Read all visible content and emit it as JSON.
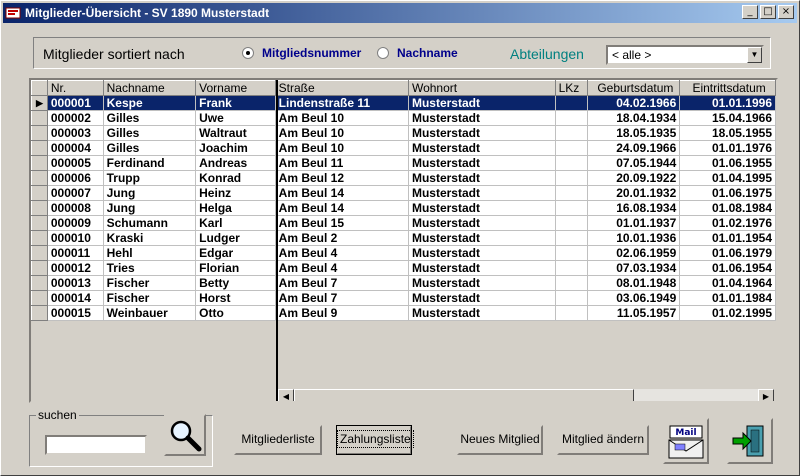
{
  "window": {
    "title": "Mitglieder-Übersicht - SV 1890 Musterstadt"
  },
  "titlebar_buttons": {
    "minimize": "_",
    "maximize": "□",
    "close": "×"
  },
  "sort": {
    "label": "Mitglieder sortiert nach",
    "options": [
      {
        "label": "Mitgliedsnummer",
        "selected": true
      },
      {
        "label": "Nachname",
        "selected": false
      }
    ]
  },
  "abteilungen": {
    "label": "Abteilungen",
    "value": "< alle >"
  },
  "grid": {
    "columns": [
      "Nr.",
      "Nachname",
      "Vorname",
      "Straße",
      "Wohnort",
      "LKz",
      "Geburtsdatum",
      "Eintrittsdatum"
    ],
    "rows": [
      [
        "000001",
        "Kespe",
        "Frank",
        "Lindenstraße 11",
        "Musterstadt",
        "",
        "04.02.1966",
        "01.01.1996"
      ],
      [
        "000002",
        "Gilles",
        "Uwe",
        "Am Beul 10",
        "Musterstadt",
        "",
        "18.04.1934",
        "15.04.1966"
      ],
      [
        "000003",
        "Gilles",
        "Waltraut",
        "Am Beul 10",
        "Musterstadt",
        "",
        "18.05.1935",
        "18.05.1955"
      ],
      [
        "000004",
        "Gilles",
        "Joachim",
        "Am Beul 10",
        "Musterstadt",
        "",
        "24.09.1966",
        "01.01.1976"
      ],
      [
        "000005",
        "Ferdinand",
        "Andreas",
        "Am Beul 11",
        "Musterstadt",
        "",
        "07.05.1944",
        "01.06.1955"
      ],
      [
        "000006",
        "Trupp",
        "Konrad",
        "Am Beul 12",
        "Musterstadt",
        "",
        "20.09.1922",
        "01.04.1995"
      ],
      [
        "000007",
        "Jung",
        "Heinz",
        "Am Beul 14",
        "Musterstadt",
        "",
        "20.01.1932",
        "01.06.1975"
      ],
      [
        "000008",
        "Jung",
        "Helga",
        "Am Beul 14",
        "Musterstadt",
        "",
        "16.08.1934",
        "01.08.1984"
      ],
      [
        "000009",
        "Schumann",
        "Karl",
        "Am Beul 15",
        "Musterstadt",
        "",
        "01.01.1937",
        "01.02.1976"
      ],
      [
        "000010",
        "Kraski",
        "Ludger",
        "Am Beul 2",
        "Musterstadt",
        "",
        "10.01.1936",
        "01.01.1954"
      ],
      [
        "000011",
        "Hehl",
        "Edgar",
        "Am Beul 4",
        "Musterstadt",
        "",
        "02.06.1959",
        "01.06.1979"
      ],
      [
        "000012",
        "Tries",
        "Florian",
        "Am Beul 4",
        "Musterstadt",
        "",
        "07.03.1934",
        "01.06.1954"
      ],
      [
        "000013",
        "Fischer",
        "Betty",
        "Am Beul 7",
        "Musterstadt",
        "",
        "08.01.1948",
        "01.04.1964"
      ],
      [
        "000014",
        "Fischer",
        "Horst",
        "Am Beul 7",
        "Musterstadt",
        "",
        "03.06.1949",
        "01.01.1984"
      ],
      [
        "000015",
        "Weinbauer",
        "Otto",
        "Am Beul 9",
        "Musterstadt",
        "",
        "11.05.1957",
        "01.02.1995"
      ]
    ],
    "selected_row": 0
  },
  "search": {
    "legend": "suchen",
    "value": ""
  },
  "buttons": {
    "mitgliederliste": "Mitgliederliste",
    "zahlungsliste": "Zahlungsliste",
    "neues_mitglied": "Neues Mitglied",
    "mitglied_aendern": "Mitglied ändern",
    "mail_icon_text": "Mail"
  },
  "colors": {
    "selection": "#0a246a",
    "radio_text": "#00008b",
    "abteilungen_label": "#008080"
  }
}
